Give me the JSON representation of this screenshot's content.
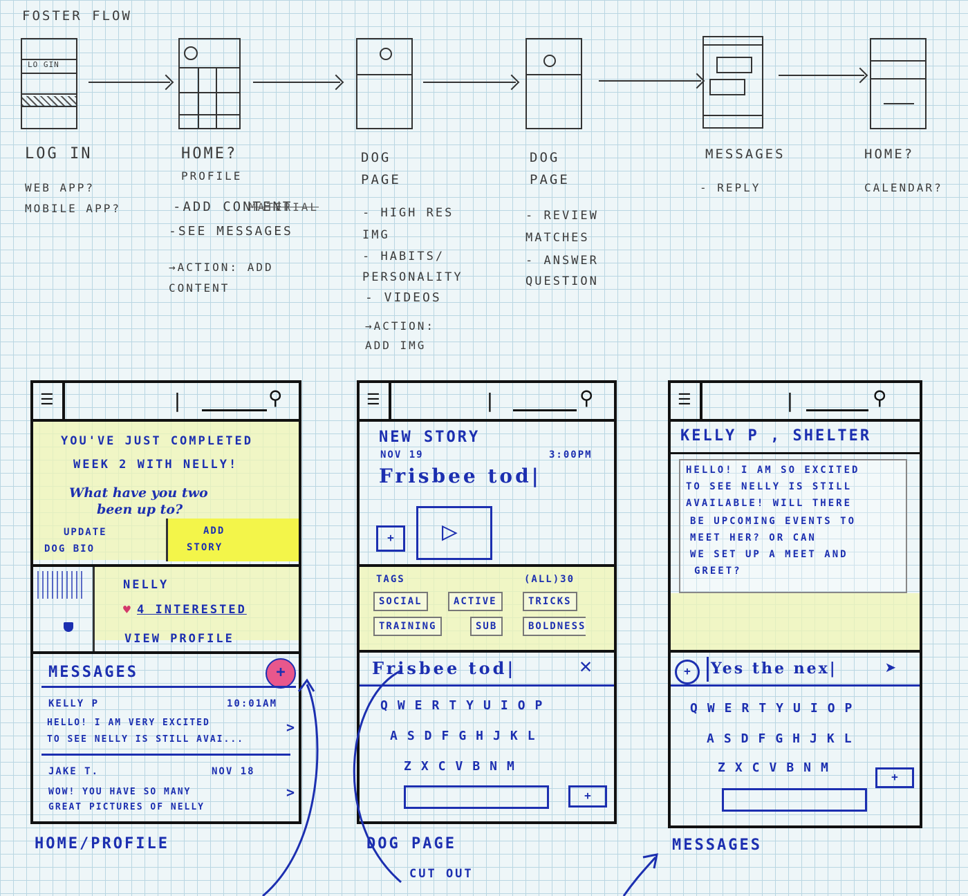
{
  "sketch_title": "FOSTER FLOW",
  "flow": [
    {
      "label": "LOG IN",
      "notes": [
        "WEB APP?",
        "MOBILE APP?"
      ],
      "thumb_text": "LO GIN"
    },
    {
      "label": "HOME?",
      "notes": [
        "PROFILE",
        "-ADD CONTENT",
        "-SEE MESSAGES",
        "→ACTION: ADD CONTENT"
      ],
      "strike": "MATERIAL"
    },
    {
      "label": "DOG PAGE",
      "notes": [
        "- HIGH RES IMG",
        "- HABITS/ PERSONALITY",
        "- VIDEOS",
        "→ACTION: ADD IMG"
      ]
    },
    {
      "label": "DOG PAGE",
      "notes": [
        "- REVIEW MATCHES",
        "- ANSWER QUESTION"
      ]
    },
    {
      "label": "MESSAGES",
      "notes": [
        "- REPLY"
      ]
    },
    {
      "label": "HOME?",
      "notes": [
        "CALENDAR?"
      ]
    }
  ],
  "home_profile": {
    "caption": "HOME/PROFILE",
    "banner_line1": "YOU'VE JUST COMPLETED",
    "banner_line2": "WEEK 2 WITH NELLY!",
    "banner_q1": "What have you two",
    "banner_q2": "been up to?",
    "update_btn_l1": "UPDATE",
    "update_btn_l2": "DOG BIO",
    "add_story_l1": "ADD",
    "add_story_l2": "STORY",
    "dog_name": "NELLY",
    "interested": "4 INTERESTED",
    "view_profile": "VIEW PROFILE",
    "messages_header": "MESSAGES",
    "add_symbol": "+",
    "messages": [
      {
        "sender": "KELLY P",
        "time": "10:01AM",
        "line1": "HELLO! I AM VERY EXCITED",
        "line2": "TO SEE NELLY IS STILL AVAI..."
      },
      {
        "sender": "JAKE T.",
        "time": "NOV 18",
        "line1": "WOW! YOU HAVE SO MANY",
        "line2": "GREAT PICTURES OF NELLY"
      }
    ],
    "chevron": ">"
  },
  "dog_page": {
    "caption": "DOG PAGE",
    "sub_caption": "CUT OUT",
    "heading": "NEW STORY",
    "date": "NOV 19",
    "time": "3:00PM",
    "story_title": "Frisbee tod|",
    "add_symbol": "+",
    "play_symbol": "▷",
    "tags_label": "TAGS",
    "tags_count": "(ALL)30",
    "tags": [
      "SOCIAL",
      "ACTIVE",
      "TRICKS",
      "TRAINING",
      "SUB",
      "BOLDNESS"
    ],
    "input_text": "Frisbee tod|",
    "kb_row1": "QWERTYUIOP",
    "kb_row2": "ASDFGHJKL",
    "kb_row3": "ZXCVBNM"
  },
  "messages_page": {
    "caption": "MESSAGES",
    "heading": "KELLY P , SHELTER",
    "message_lines": [
      "HELLO! I AM SO EXCITED",
      "TO SEE NELLY IS STILL",
      "AVAILABLE! WILL THERE",
      "BE UPCOMING EVENTS TO",
      "MEET HER? OR CAN",
      "WE SET UP A MEET AND",
      "GREET?"
    ],
    "reply_text": "Yes the nex|",
    "add_symbol": "+",
    "kb_row1": "QWERTYUIOP",
    "kb_row2": "ASDFGHJKL",
    "kb_row3": "ZXCVBNM"
  }
}
